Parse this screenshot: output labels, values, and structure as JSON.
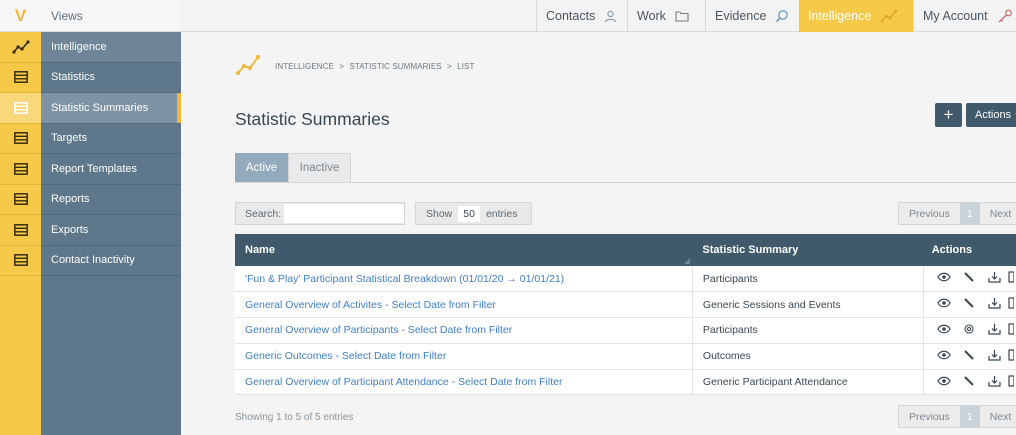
{
  "app": {
    "logo_letter": "V",
    "section_label": "Views"
  },
  "nav": {
    "items": [
      {
        "label": "Intelligence",
        "icon": "chart-line-icon",
        "kind": "header"
      },
      {
        "label": "Statistics",
        "icon": "list-icon",
        "kind": "item"
      },
      {
        "label": "Statistic Summaries",
        "icon": "list-icon",
        "kind": "active"
      },
      {
        "label": "Targets",
        "icon": "list-icon",
        "kind": "item"
      },
      {
        "label": "Report Templates",
        "icon": "list-icon",
        "kind": "item"
      },
      {
        "label": "Reports",
        "icon": "list-icon",
        "kind": "item"
      },
      {
        "label": "Exports",
        "icon": "list-icon",
        "kind": "item"
      },
      {
        "label": "Contact Inactivity",
        "icon": "list-icon",
        "kind": "item"
      }
    ]
  },
  "topbar": {
    "tabs": [
      {
        "label": "Contacts",
        "icon": "person-icon",
        "active": false
      },
      {
        "label": "Work",
        "icon": "folder-icon",
        "active": false
      },
      {
        "label": "Evidence",
        "icon": "search-icon",
        "active": false
      },
      {
        "label": "Intelligence",
        "icon": "chart-line-icon",
        "active": true
      },
      {
        "label": "My Account",
        "icon": "key-icon",
        "active": false
      }
    ]
  },
  "breadcrumb": {
    "parts": [
      "INTELLIGENCE",
      "STATISTIC SUMMARIES",
      "LIST"
    ],
    "separator": ">"
  },
  "page": {
    "title": "Statistic Summaries",
    "add_button": "+",
    "actions_button": "Actions"
  },
  "status_tabs": {
    "active": "Active",
    "inactive": "Inactive"
  },
  "filters": {
    "search_label": "Search:",
    "search_value": "",
    "show_label": "Show",
    "show_value": "50",
    "entries_label": "entries"
  },
  "pagination": {
    "previous": "Previous",
    "current": "1",
    "next": "Next"
  },
  "table": {
    "columns": [
      "Name",
      "Statistic Summary",
      "Actions"
    ],
    "rows": [
      {
        "name": "'Fun & Play' Participant Statistical Breakdown (01/01/20 → 01/01/21)",
        "summary": "Participants",
        "edit_icon": "pencil-icon"
      },
      {
        "name": "General Overview of Activites - Select Date from Filter",
        "summary": "Generic Sessions and Events",
        "edit_icon": "pencil-icon"
      },
      {
        "name": "General Overview of Participants - Select Date from Filter",
        "summary": "Participants",
        "edit_icon": "settings-icon"
      },
      {
        "name": "Generic Outcomes - Select Date from Filter",
        "summary": "Outcomes",
        "edit_icon": "pencil-icon"
      },
      {
        "name": "General Overview of Participant Attendance - Select Date from Filter",
        "summary": "Generic Participant Attendance",
        "edit_icon": "pencil-icon"
      }
    ]
  },
  "footer": {
    "info": "Showing 1 to 5 of 5 entries"
  },
  "colors": {
    "brand_yellow": "#f7c948",
    "nav_slate": "#5e778a",
    "header_dark": "#40596b",
    "link_blue": "#3f7fc7"
  }
}
